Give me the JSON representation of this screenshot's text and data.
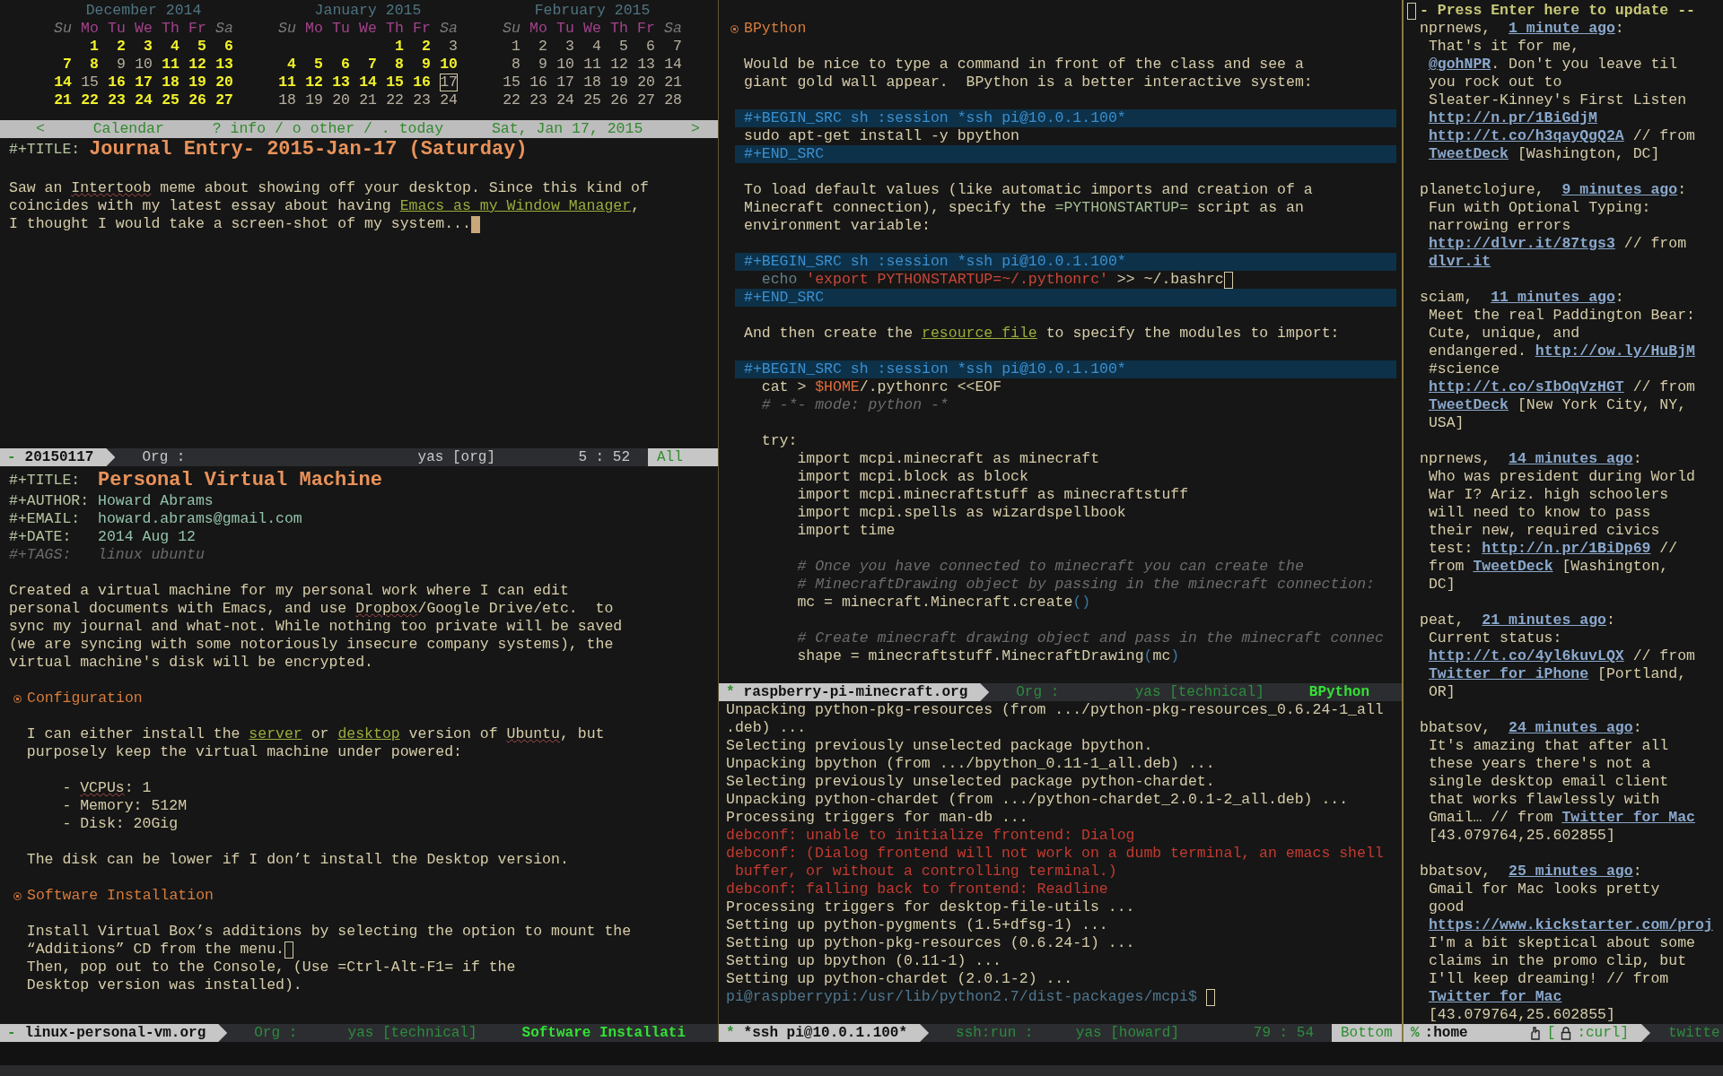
{
  "calendar": {
    "months": [
      {
        "title": "December 2014",
        "weekdays": [
          {
            "label": "Su",
            "weekend": true
          },
          {
            "label": "Mo",
            "weekend": false
          },
          {
            "label": "Tu",
            "weekend": false
          },
          {
            "label": "We",
            "weekend": false
          },
          {
            "label": "Th",
            "weekend": false
          },
          {
            "label": "Fr",
            "weekend": false
          },
          {
            "label": "Sa",
            "weekend": true
          }
        ],
        "weeks": [
          [
            {
              "day": "1",
              "marked": true,
              "selected": false
            },
            {
              "day": "2",
              "marked": true,
              "selected": false
            },
            {
              "day": "3",
              "marked": true,
              "selected": false
            },
            {
              "day": "4",
              "marked": true,
              "selected": false
            },
            {
              "day": "5",
              "marked": true,
              "selected": false
            },
            {
              "day": "6",
              "marked": true,
              "selected": false
            }
          ],
          [
            {
              "day": "7",
              "marked": true,
              "selected": false
            },
            {
              "day": "8",
              "marked": true,
              "selected": false
            },
            {
              "day": "9",
              "marked": false,
              "selected": false
            },
            {
              "day": "10",
              "marked": false,
              "selected": false
            },
            {
              "day": "11",
              "marked": true,
              "selected": false
            },
            {
              "day": "12",
              "marked": true,
              "selected": false
            },
            {
              "day": "13",
              "marked": true,
              "selected": false
            }
          ],
          [
            {
              "day": "14",
              "marked": true,
              "selected": false
            },
            {
              "day": "15",
              "marked": false,
              "selected": false
            },
            {
              "day": "16",
              "marked": true,
              "selected": false
            },
            {
              "day": "17",
              "marked": true,
              "selected": false
            },
            {
              "day": "18",
              "marked": true,
              "selected": false
            },
            {
              "day": "19",
              "marked": true,
              "selected": false
            },
            {
              "day": "20",
              "marked": true,
              "selected": false
            }
          ],
          [
            {
              "day": "21",
              "marked": true,
              "selected": false
            },
            {
              "day": "22",
              "marked": true,
              "selected": false
            },
            {
              "day": "23",
              "marked": true,
              "selected": false
            },
            {
              "day": "24",
              "marked": true,
              "selected": false
            },
            {
              "day": "25",
              "marked": true,
              "selected": false
            },
            {
              "day": "26",
              "marked": true,
              "selected": false
            },
            {
              "day": "27",
              "marked": true,
              "selected": false
            }
          ]
        ]
      },
      {
        "title": "January 2015",
        "weekdays": [
          {
            "label": "Su",
            "weekend": true
          },
          {
            "label": "Mo",
            "weekend": false
          },
          {
            "label": "Tu",
            "weekend": false
          },
          {
            "label": "We",
            "weekend": false
          },
          {
            "label": "Th",
            "weekend": false
          },
          {
            "label": "Fr",
            "weekend": false
          },
          {
            "label": "Sa",
            "weekend": true
          }
        ],
        "weeks": [
          [
            {
              "day": "1",
              "marked": true,
              "selected": false
            },
            {
              "day": "2",
              "marked": true,
              "selected": false
            },
            {
              "day": "3",
              "marked": false,
              "selected": false
            }
          ],
          [
            {
              "day": "4",
              "marked": true,
              "selected": false
            },
            {
              "day": "5",
              "marked": true,
              "selected": false
            },
            {
              "day": "6",
              "marked": true,
              "selected": false
            },
            {
              "day": "7",
              "marked": true,
              "selected": false
            },
            {
              "day": "8",
              "marked": true,
              "selected": false
            },
            {
              "day": "9",
              "marked": true,
              "selected": false
            },
            {
              "day": "10",
              "marked": true,
              "selected": false
            }
          ],
          [
            {
              "day": "11",
              "marked": true,
              "selected": false
            },
            {
              "day": "12",
              "marked": true,
              "selected": false
            },
            {
              "day": "13",
              "marked": true,
              "selected": false
            },
            {
              "day": "14",
              "marked": true,
              "selected": false
            },
            {
              "day": "15",
              "marked": true,
              "selected": false
            },
            {
              "day": "16",
              "marked": true,
              "selected": false
            },
            {
              "day": "17",
              "marked": false,
              "selected": true
            }
          ],
          [
            {
              "day": "18",
              "marked": false,
              "selected": false
            },
            {
              "day": "19",
              "marked": false,
              "selected": false
            },
            {
              "day": "20",
              "marked": false,
              "selected": false
            },
            {
              "day": "21",
              "marked": false,
              "selected": false
            },
            {
              "day": "22",
              "marked": false,
              "selected": false
            },
            {
              "day": "23",
              "marked": false,
              "selected": false
            },
            {
              "day": "24",
              "marked": false,
              "selected": false
            }
          ]
        ]
      },
      {
        "title": "February 2015",
        "weekdays": [
          {
            "label": "Su",
            "weekend": true
          },
          {
            "label": "Mo",
            "weekend": false
          },
          {
            "label": "Tu",
            "weekend": false
          },
          {
            "label": "We",
            "weekend": false
          },
          {
            "label": "Th",
            "weekend": false
          },
          {
            "label": "Fr",
            "weekend": false
          },
          {
            "label": "Sa",
            "weekend": true
          }
        ],
        "weeks": [
          [
            {
              "day": "1",
              "marked": false,
              "selected": false
            },
            {
              "day": "2",
              "marked": false,
              "selected": false
            },
            {
              "day": "3",
              "marked": false,
              "selected": false
            },
            {
              "day": "4",
              "marked": false,
              "selected": false
            },
            {
              "day": "5",
              "marked": false,
              "selected": false
            },
            {
              "day": "6",
              "marked": false,
              "selected": false
            },
            {
              "day": "7",
              "marked": false,
              "selected": false
            }
          ],
          [
            {
              "day": "8",
              "marked": false,
              "selected": false
            },
            {
              "day": "9",
              "marked": false,
              "selected": false
            },
            {
              "day": "10",
              "marked": false,
              "selected": false
            },
            {
              "day": "11",
              "marked": false,
              "selected": false
            },
            {
              "day": "12",
              "marked": false,
              "selected": false
            },
            {
              "day": "13",
              "marked": false,
              "selected": false
            },
            {
              "day": "14",
              "marked": false,
              "selected": false
            }
          ],
          [
            {
              "day": "15",
              "marked": false,
              "selected": false
            },
            {
              "day": "16",
              "marked": false,
              "selected": false
            },
            {
              "day": "17",
              "marked": false,
              "selected": false
            },
            {
              "day": "18",
              "marked": false,
              "selected": false
            },
            {
              "day": "19",
              "marked": false,
              "selected": false
            },
            {
              "day": "20",
              "marked": false,
              "selected": false
            },
            {
              "day": "21",
              "marked": false,
              "selected": false
            }
          ],
          [
            {
              "day": "22",
              "marked": false,
              "selected": false
            },
            {
              "day": "23",
              "marked": false,
              "selected": false
            },
            {
              "day": "24",
              "marked": false,
              "selected": false
            },
            {
              "day": "25",
              "marked": false,
              "selected": false
            },
            {
              "day": "26",
              "marked": false,
              "selected": false
            },
            {
              "day": "27",
              "marked": false,
              "selected": false
            },
            {
              "day": "28",
              "marked": false,
              "selected": false
            }
          ]
        ]
      }
    ],
    "header": [
      "<",
      "Calendar",
      "? info / o other / . today",
      "Sat, Jan 17, 2015",
      ">"
    ]
  },
  "journal_window": {
    "lines": [
      {
        "kind": "mixed",
        "segments": [
          {
            "kind": "keyword",
            "text": "#+TITLE: "
          },
          {
            "kind": "title",
            "text": "Journal Entry- 2015-Jan-17 (Saturday)"
          }
        ]
      },
      {
        "kind": "blank"
      },
      {
        "kind": "mixed",
        "segments": [
          {
            "kind": "plain",
            "text": "Saw an "
          },
          {
            "kind": "spell",
            "text": "Intertoob"
          },
          {
            "kind": "plain",
            "text": " meme about showing off your desktop. Since this kind of"
          }
        ]
      },
      {
        "kind": "mixed",
        "segments": [
          {
            "kind": "plain",
            "text": "coincides with my latest essay about having "
          },
          {
            "kind": "link",
            "text": "Emacs as my Window Manager"
          },
          {
            "kind": "plain",
            "text": ","
          }
        ]
      },
      {
        "kind": "mixed",
        "segments": [
          {
            "kind": "plain",
            "text": "I thought I would take a screen-shot of my system..."
          },
          {
            "kind": "cursor"
          }
        ]
      }
    ],
    "modeline": {
      "active": true,
      "buffer": {
        "mark": "-",
        "name": "20150117"
      },
      "segments": [
        {
          "kind": "mode",
          "text": "Org :"
        },
        {
          "kind": "minor",
          "text": "yas [org]"
        },
        {
          "kind": "position",
          "text": "5 : 52"
        },
        {
          "kind": "scroll",
          "text": "All"
        }
      ]
    }
  },
  "vm_window": {
    "lines": [
      {
        "kind": "mixed",
        "segments": [
          {
            "kind": "keyword",
            "text": "#+TITLE:  "
          },
          {
            "kind": "title",
            "text": "Personal Virtual Machine"
          }
        ]
      },
      {
        "kind": "mixed",
        "segments": [
          {
            "kind": "keyword",
            "text": "#+AUTHOR: "
          },
          {
            "kind": "meta",
            "text": "Howard Abrams"
          }
        ]
      },
      {
        "kind": "mixed",
        "segments": [
          {
            "kind": "keyword",
            "text": "#+EMAIL:  "
          },
          {
            "kind": "meta",
            "text": "howard.abrams@gmail.com"
          }
        ]
      },
      {
        "kind": "mixed",
        "segments": [
          {
            "kind": "keyword",
            "text": "#+DATE:   "
          },
          {
            "kind": "meta",
            "text": "2014 Aug 12"
          }
        ]
      },
      {
        "kind": "mixed",
        "segments": [
          {
            "kind": "comment",
            "text": "#+TAGS:   "
          },
          {
            "kind": "comment",
            "text": "linux ubuntu"
          }
        ]
      },
      {
        "kind": "blank"
      },
      {
        "kind": "plain",
        "text": "Created a virtual machine for my personal work where I can edit"
      },
      {
        "kind": "mixed",
        "segments": [
          {
            "kind": "plain",
            "text": "personal documents with Emacs, and use "
          },
          {
            "kind": "spell",
            "text": "Dropbox"
          },
          {
            "kind": "plain",
            "text": "/Google Drive/etc.  to"
          }
        ]
      },
      {
        "kind": "plain",
        "text": "sync my journal and what-not. While nothing too private will be saved"
      },
      {
        "kind": "plain",
        "text": "(we are syncing with some notoriously insecure company systems), the"
      },
      {
        "kind": "plain",
        "text": "virtual machine's disk will be encrypted."
      },
      {
        "kind": "blank"
      },
      {
        "kind": "heading",
        "text": "Configuration"
      },
      {
        "kind": "blank"
      },
      {
        "kind": "mixed",
        "segments": [
          {
            "kind": "plain",
            "text": "  I can either install the "
          },
          {
            "kind": "link",
            "text": "server"
          },
          {
            "kind": "plain",
            "text": " or "
          },
          {
            "kind": "link",
            "text": "desktop"
          },
          {
            "kind": "plain",
            "text": " version of "
          },
          {
            "kind": "spell",
            "text": "Ubuntu"
          },
          {
            "kind": "plain",
            "text": ", but"
          }
        ]
      },
      {
        "kind": "plain",
        "text": "  purposely keep the virtual machine under powered:"
      },
      {
        "kind": "blank"
      },
      {
        "kind": "mixed",
        "segments": [
          {
            "kind": "plain",
            "text": "      - "
          },
          {
            "kind": "spell",
            "text": "VCPUs"
          },
          {
            "kind": "plain",
            "text": ": 1"
          }
        ]
      },
      {
        "kind": "plain",
        "text": "      - Memory: 512M"
      },
      {
        "kind": "plain",
        "text": "      - Disk: 20Gig"
      },
      {
        "kind": "blank"
      },
      {
        "kind": "plain",
        "text": "  The disk can be lower if I don’t install the Desktop version."
      },
      {
        "kind": "blank"
      },
      {
        "kind": "heading",
        "text": "Software Installation"
      },
      {
        "kind": "blank"
      },
      {
        "kind": "plain",
        "text": "  Install Virtual Box’s additions by selecting the option to mount the"
      },
      {
        "kind": "mixed",
        "segments": [
          {
            "kind": "plain",
            "text": "  “Additions” CD from the menu."
          },
          {
            "kind": "box-cursor"
          }
        ]
      },
      {
        "kind": "plain",
        "text": "  Then, pop out to the Console, (Use =Ctrl-Alt-F1= if the"
      },
      {
        "kind": "plain",
        "text": "  Desktop version was installed)."
      }
    ],
    "modeline": {
      "active": false,
      "buffer": {
        "mark": "-",
        "name": "linux-personal-vm.org"
      },
      "segments": [
        {
          "kind": "mode",
          "text": "Org :"
        },
        {
          "kind": "minor",
          "text": "yas [technical]"
        },
        {
          "kind": "function",
          "text": "Software Installati"
        }
      ]
    }
  },
  "org_window": {
    "lines": [
      {
        "kind": "blank"
      },
      {
        "kind": "heading",
        "text": "BPython"
      },
      {
        "kind": "blank"
      },
      {
        "kind": "plain",
        "text": "Would be nice to type a command in front of the class and see a"
      },
      {
        "kind": "plain",
        "text": "giant gold wall appear.  BPython is a better interactive system:"
      },
      {
        "kind": "blank"
      },
      {
        "kind": "src-begin",
        "text": "#+BEGIN_SRC sh :session *ssh pi@10.0.1.100*"
      },
      {
        "kind": "code",
        "text": "sudo apt-get install -y bpython"
      },
      {
        "kind": "src-end",
        "text": "#+END_SRC"
      },
      {
        "kind": "blank"
      },
      {
        "kind": "plain",
        "text": "To load default values (like automatic imports and creation of a"
      },
      {
        "kind": "mixed",
        "segments": [
          {
            "kind": "plain",
            "text": "Minecraft connection), specify the "
          },
          {
            "kind": "verbatim",
            "text": "=PYTHONSTARTUP="
          },
          {
            "kind": "plain",
            "text": " script as an"
          }
        ]
      },
      {
        "kind": "plain",
        "text": "environment variable:"
      },
      {
        "kind": "blank"
      },
      {
        "kind": "src-begin",
        "text": "#+BEGIN_SRC sh :session *ssh pi@10.0.1.100*"
      },
      {
        "kind": "continuation",
        "segments": [
          {
            "kind": "builtin",
            "text": "echo "
          },
          {
            "kind": "string",
            "text": "'export PYTHONSTARTUP=~/.pythonrc'"
          },
          {
            "kind": "code",
            "text": " >> ~/.bashrc"
          },
          {
            "kind": "box-cursor"
          }
        ]
      },
      {
        "kind": "src-end",
        "text": "#+END_SRC"
      },
      {
        "kind": "blank"
      },
      {
        "kind": "mixed",
        "segments": [
          {
            "kind": "plain",
            "text": "And then create the "
          },
          {
            "kind": "link",
            "text": "resource file"
          },
          {
            "kind": "plain",
            "text": " to specify the modules to import:"
          }
        ]
      },
      {
        "kind": "blank"
      },
      {
        "kind": "src-begin",
        "text": "#+BEGIN_SRC sh :session *ssh pi@10.0.1.100*"
      },
      {
        "kind": "mixed",
        "segments": [
          {
            "kind": "code",
            "text": "  cat > "
          },
          {
            "kind": "var",
            "text": "$HOME"
          },
          {
            "kind": "code",
            "text": "/.pythonrc <<EOF"
          }
        ]
      },
      {
        "kind": "comment",
        "text": "  # -*- mode: python -*"
      },
      {
        "kind": "blank"
      },
      {
        "kind": "code",
        "text": "  try:"
      },
      {
        "kind": "code",
        "text": "      import mcpi.minecraft as minecraft"
      },
      {
        "kind": "code",
        "text": "      import mcpi.block as block"
      },
      {
        "kind": "code",
        "text": "      import mcpi.minecraftstuff as minecraftstuff"
      },
      {
        "kind": "code",
        "text": "      import mcpi.spells as wizardspellbook"
      },
      {
        "kind": "code",
        "text": "      import time"
      },
      {
        "kind": "blank"
      },
      {
        "kind": "comment",
        "text": "      # Once you have connected to minecraft you can create the"
      },
      {
        "kind": "comment",
        "text": "      # MinecraftDrawing object by passing in the minecraft connection:"
      },
      {
        "kind": "mixed",
        "segments": [
          {
            "kind": "code",
            "text": "      mc = minecraft.Minecraft.create"
          },
          {
            "kind": "paren",
            "text": "()"
          }
        ]
      },
      {
        "kind": "blank"
      },
      {
        "kind": "comment",
        "text": "      # Create minecraft drawing object and pass in the minecraft connec"
      },
      {
        "kind": "mixed",
        "segments": [
          {
            "kind": "code",
            "text": "      shape = minecraftstuff.MinecraftDrawing"
          },
          {
            "kind": "paren",
            "text": "("
          },
          {
            "kind": "code",
            "text": "mc"
          },
          {
            "kind": "paren",
            "text": ")"
          }
        ]
      }
    ],
    "modeline": {
      "active": false,
      "buffer": {
        "mark": "*",
        "name": "raspberry-pi-minecraft.org"
      },
      "segments": [
        {
          "kind": "mode",
          "text": "Org :"
        },
        {
          "kind": "minor",
          "text": "yas [technical]"
        },
        {
          "kind": "function",
          "text": "BPython"
        }
      ]
    }
  },
  "shell_window": {
    "lines": [
      {
        "kind": "plain",
        "text": "Unpacking python-pkg-resources (from .../python-pkg-resources_0.6.24-1_all"
      },
      {
        "kind": "plain",
        "text": ".deb) ..."
      },
      {
        "kind": "plain",
        "text": "Selecting previously unselected package bpython."
      },
      {
        "kind": "plain",
        "text": "Unpacking bpython (from .../bpython_0.11-1_all.deb) ..."
      },
      {
        "kind": "plain",
        "text": "Selecting previously unselected package python-chardet."
      },
      {
        "kind": "plain",
        "text": "Unpacking python-chardet (from .../python-chardet_2.0.1-2_all.deb) ..."
      },
      {
        "kind": "plain",
        "text": "Processing triggers for man-db ..."
      },
      {
        "kind": "error",
        "text": "debconf: unable to initialize frontend: Dialog"
      },
      {
        "kind": "error",
        "text": "debconf: (Dialog frontend will not work on a dumb terminal, an emacs shell"
      },
      {
        "kind": "error",
        "text": " buffer, or without a controlling terminal.)"
      },
      {
        "kind": "error",
        "text": "debconf: falling back to frontend: Readline"
      },
      {
        "kind": "plain",
        "text": "Processing triggers for desktop-file-utils ..."
      },
      {
        "kind": "plain",
        "text": "Setting up python-pygments (1.5+dfsg-1) ..."
      },
      {
        "kind": "plain",
        "text": "Setting up python-pkg-resources (0.6.24-1) ..."
      },
      {
        "kind": "plain",
        "text": "Setting up bpython (0.11-1) ..."
      },
      {
        "kind": "plain",
        "text": "Setting up python-chardet (2.0.1-2) ..."
      },
      {
        "kind": "mixed",
        "segments": [
          {
            "kind": "prompt",
            "text": "pi@raspberrypi:/usr/lib/python2.7/dist-packages/mcpi$ "
          },
          {
            "kind": "box-cursor"
          }
        ]
      }
    ],
    "modeline": {
      "active": false,
      "buffer": {
        "mark": "*",
        "name": "*ssh pi@10.0.1.100*"
      },
      "segments": [
        {
          "kind": "mode",
          "text": "ssh:run :"
        },
        {
          "kind": "minor",
          "text": "yas [howard]"
        },
        {
          "kind": "position",
          "text": "79 : 54"
        },
        {
          "kind": "scroll",
          "text": "Bottom"
        }
      ]
    }
  },
  "twitter_window": {
    "lines": [
      {
        "kind": "mixed",
        "segments": [
          {
            "kind": "box-cursor"
          },
          {
            "kind": "header",
            "text": "- Press Enter here to update --"
          }
        ]
      },
      {
        "kind": "mixed",
        "segments": [
          {
            "kind": "user",
            "text": "nprnews,  "
          },
          {
            "kind": "time",
            "text": "1 minute ago"
          },
          {
            "kind": "plain",
            "text": ":"
          }
        ]
      },
      {
        "kind": "plain",
        "text": " That's it for me,"
      },
      {
        "kind": "continuation",
        "segments": [
          {
            "kind": "url",
            "text": "@gohNPR"
          },
          {
            "kind": "plain",
            "text": ". Don't you leave til"
          }
        ]
      },
      {
        "kind": "plain",
        "text": " you rock out to"
      },
      {
        "kind": "plain",
        "text": " Sleater-Kinney's First Listen"
      },
      {
        "kind": "continuation",
        "segments": [
          {
            "kind": "url",
            "text": "http://n.pr/1BiGdjM"
          }
        ]
      },
      {
        "kind": "continuation",
        "segments": [
          {
            "kind": "url",
            "text": "http://t.co/h3qayQgQ2A"
          },
          {
            "kind": "plain",
            "text": " // from"
          }
        ]
      },
      {
        "kind": "continuation",
        "segments": [
          {
            "kind": "url",
            "text": "TweetDeck"
          },
          {
            "kind": "plain",
            "text": " [Washington, DC]"
          }
        ]
      },
      {
        "kind": "blank"
      },
      {
        "kind": "mixed",
        "segments": [
          {
            "kind": "user",
            "text": "planetclojure,  "
          },
          {
            "kind": "time",
            "text": "9 minutes ago"
          },
          {
            "kind": "plain",
            "text": ":"
          }
        ]
      },
      {
        "kind": "plain",
        "text": " Fun with Optional Typing:"
      },
      {
        "kind": "plain",
        "text": " narrowing errors"
      },
      {
        "kind": "continuation",
        "segments": [
          {
            "kind": "url",
            "text": "http://dlvr.it/87tgs3"
          },
          {
            "kind": "plain",
            "text": " // from"
          }
        ]
      },
      {
        "kind": "continuation",
        "segments": [
          {
            "kind": "url",
            "text": "dlvr.it"
          }
        ]
      },
      {
        "kind": "blank"
      },
      {
        "kind": "mixed",
        "segments": [
          {
            "kind": "user",
            "text": "sciam,  "
          },
          {
            "kind": "time",
            "text": "11 minutes ago"
          },
          {
            "kind": "plain",
            "text": ":"
          }
        ]
      },
      {
        "kind": "plain",
        "text": " Meet the real Paddington Bear:"
      },
      {
        "kind": "plain",
        "text": " Cute, unique, and"
      },
      {
        "kind": "mixed",
        "segments": [
          {
            "kind": "plain",
            "text": " endangered. "
          },
          {
            "kind": "url",
            "text": "http://ow.ly/HuBjM"
          }
        ]
      },
      {
        "kind": "plain",
        "text": " #science"
      },
      {
        "kind": "continuation",
        "segments": [
          {
            "kind": "url",
            "text": "http://t.co/sIbOqVzHGT"
          },
          {
            "kind": "plain",
            "text": " // from"
          }
        ]
      },
      {
        "kind": "continuation",
        "segments": [
          {
            "kind": "url",
            "text": "TweetDeck"
          },
          {
            "kind": "plain",
            "text": " [New York City, NY,"
          }
        ]
      },
      {
        "kind": "plain",
        "text": " USA]"
      },
      {
        "kind": "blank"
      },
      {
        "kind": "mixed",
        "segments": [
          {
            "kind": "user",
            "text": "nprnews,  "
          },
          {
            "kind": "time",
            "text": "14 minutes ago"
          },
          {
            "kind": "plain",
            "text": ":"
          }
        ]
      },
      {
        "kind": "plain",
        "text": " Who was president during World"
      },
      {
        "kind": "plain",
        "text": " War I? Ariz. high schoolers"
      },
      {
        "kind": "plain",
        "text": " will need to know to pass"
      },
      {
        "kind": "plain",
        "text": " their new, required civics"
      },
      {
        "kind": "mixed",
        "segments": [
          {
            "kind": "plain",
            "text": " test: "
          },
          {
            "kind": "url",
            "text": "http://n.pr/1BiDp69"
          },
          {
            "kind": "plain",
            "text": " //"
          }
        ]
      },
      {
        "kind": "mixed",
        "segments": [
          {
            "kind": "plain",
            "text": " from "
          },
          {
            "kind": "url",
            "text": "TweetDeck"
          },
          {
            "kind": "plain",
            "text": " [Washington,"
          }
        ]
      },
      {
        "kind": "plain",
        "text": " DC]"
      },
      {
        "kind": "blank"
      },
      {
        "kind": "mixed",
        "segments": [
          {
            "kind": "user",
            "text": "peat,  "
          },
          {
            "kind": "time",
            "text": "21 minutes ago"
          },
          {
            "kind": "plain",
            "text": ":"
          }
        ]
      },
      {
        "kind": "plain",
        "text": " Current status:"
      },
      {
        "kind": "continuation",
        "segments": [
          {
            "kind": "url",
            "text": "http://t.co/4yl6kuvLQX"
          },
          {
            "kind": "plain",
            "text": " // from"
          }
        ]
      },
      {
        "kind": "continuation",
        "segments": [
          {
            "kind": "url",
            "text": "Twitter for iPhone"
          },
          {
            "kind": "plain",
            "text": " [Portland,"
          }
        ]
      },
      {
        "kind": "plain",
        "text": " OR]"
      },
      {
        "kind": "blank"
      },
      {
        "kind": "mixed",
        "segments": [
          {
            "kind": "user",
            "text": "bbatsov,  "
          },
          {
            "kind": "time",
            "text": "24 minutes ago"
          },
          {
            "kind": "plain",
            "text": ":"
          }
        ]
      },
      {
        "kind": "plain",
        "text": " It's amazing that after all"
      },
      {
        "kind": "plain",
        "text": " these years there's not a"
      },
      {
        "kind": "plain",
        "text": " single desktop email client"
      },
      {
        "kind": "plain",
        "text": " that works flawlessly with"
      },
      {
        "kind": "mixed",
        "segments": [
          {
            "kind": "plain",
            "text": " Gmail… // from "
          },
          {
            "kind": "url",
            "text": "Twitter for Mac"
          }
        ]
      },
      {
        "kind": "plain",
        "text": " [43.079764,25.602855]"
      },
      {
        "kind": "blank"
      },
      {
        "kind": "mixed",
        "segments": [
          {
            "kind": "user",
            "text": "bbatsov,  "
          },
          {
            "kind": "time",
            "text": "25 minutes ago"
          },
          {
            "kind": "plain",
            "text": ":"
          }
        ]
      },
      {
        "kind": "plain",
        "text": " Gmail for Mac looks pretty"
      },
      {
        "kind": "plain",
        "text": " good"
      },
      {
        "kind": "continuation",
        "segments": [
          {
            "kind": "url",
            "text": "https://www.kickstarter.com/proj"
          }
        ]
      },
      {
        "kind": "plain",
        "text": " I'm a bit skeptical about some"
      },
      {
        "kind": "plain",
        "text": " claims in the promo clip, but"
      },
      {
        "kind": "plain",
        "text": " I'll keep dreaming! // from"
      },
      {
        "kind": "continuation",
        "segments": [
          {
            "kind": "url",
            "text": "Twitter for Mac"
          }
        ]
      },
      {
        "kind": "plain",
        "text": " [43.079764,25.602855]"
      }
    ],
    "modeline": {
      "active": false,
      "buffer": {
        "mark": "%",
        "name": ":home",
        "process": {
          "open": "[",
          "name": ":curl]"
        }
      },
      "segments": [
        {
          "kind": "mode",
          "text": "twitte"
        }
      ]
    }
  }
}
